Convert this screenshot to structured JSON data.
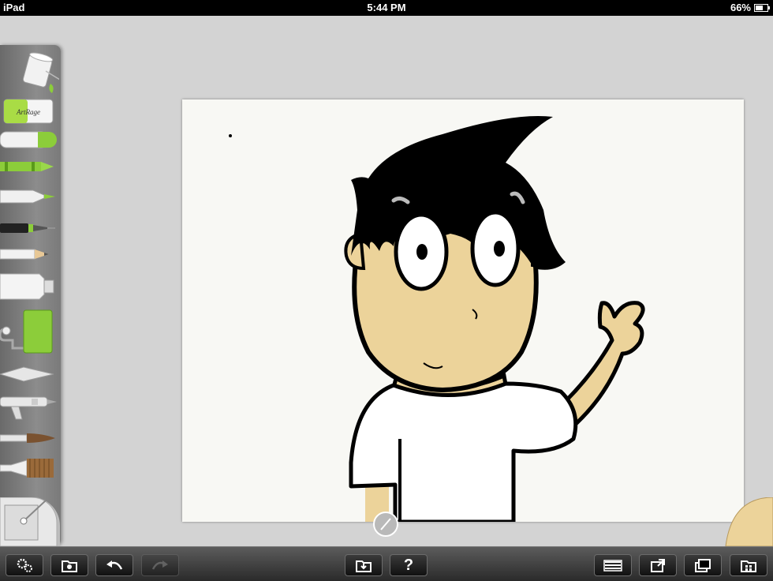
{
  "status_bar": {
    "device": "iPad",
    "time": "5:44 PM",
    "battery": "66%",
    "battery_level": 0.66
  },
  "tools": {
    "items": [
      "paint-bucket-icon",
      "artrage-eraser-icon",
      "palette-knife-icon",
      "crayon-icon",
      "felt-marker-icon",
      "inking-pen-icon",
      "pencil-icon",
      "paint-tube-icon",
      "paint-roller-icon",
      "spatula-icon",
      "airbrush-icon",
      "watercolor-brush-icon",
      "oil-brush-icon"
    ],
    "eraser_label": "ArtRage"
  },
  "colors": {
    "skin": "#ecd39a",
    "accent": "#8ccd3a",
    "ink": "#000000"
  },
  "toolbar": {
    "buttons": [
      "settings",
      "gallery",
      "undo",
      "redo",
      "file",
      "help",
      "layers",
      "share",
      "references",
      "gallery-grid"
    ],
    "help_label": "?"
  }
}
